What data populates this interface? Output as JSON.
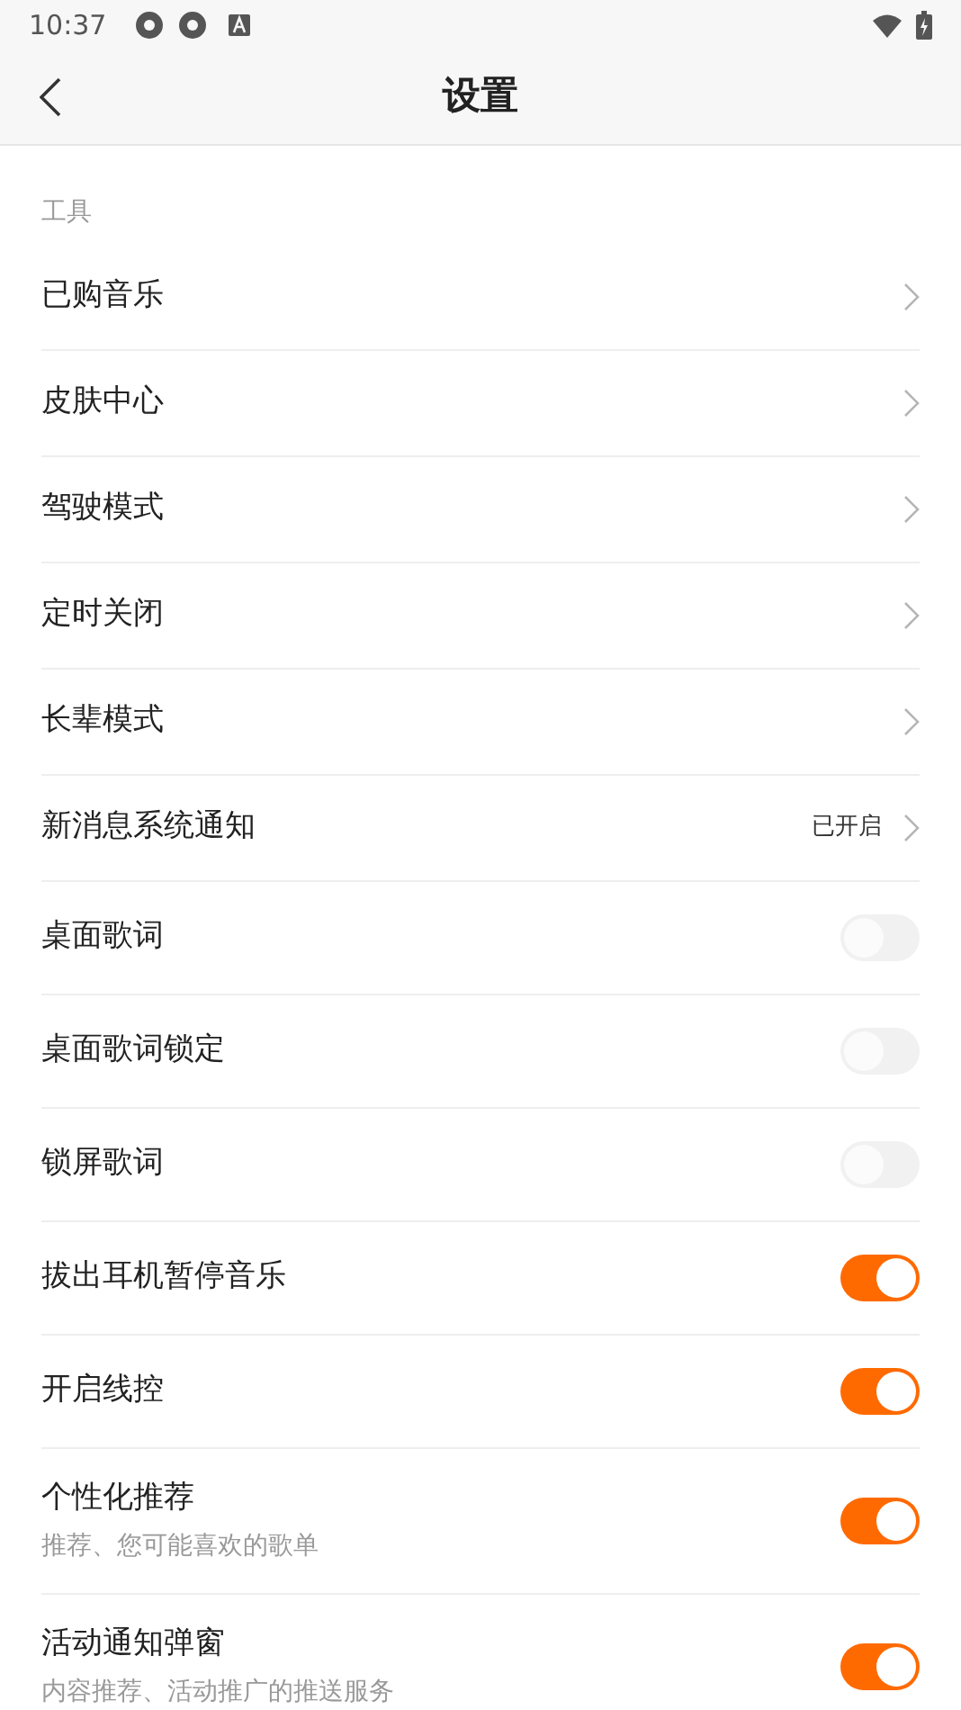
{
  "status_bar": {
    "time": "10:37"
  },
  "header": {
    "title": "设置"
  },
  "section": {
    "title": "工具"
  },
  "rows": [
    {
      "kind": "link",
      "label": "已购音乐"
    },
    {
      "kind": "link",
      "label": "皮肤中心"
    },
    {
      "kind": "link",
      "label": "驾驶模式"
    },
    {
      "kind": "link",
      "label": "定时关闭"
    },
    {
      "kind": "link",
      "label": "长辈模式"
    },
    {
      "kind": "link",
      "label": "新消息系统通知",
      "value": "已开启"
    },
    {
      "kind": "toggle",
      "label": "桌面歌词",
      "on": false
    },
    {
      "kind": "toggle",
      "label": "桌面歌词锁定",
      "on": false
    },
    {
      "kind": "toggle",
      "label": "锁屏歌词",
      "on": false
    },
    {
      "kind": "toggle",
      "label": "拔出耳机暂停音乐",
      "on": true
    },
    {
      "kind": "toggle",
      "label": "开启线控",
      "on": true
    },
    {
      "kind": "toggle",
      "label": "个性化推荐",
      "subtitle": "推荐、您可能喜欢的歌单",
      "on": true
    },
    {
      "kind": "toggle",
      "label": "活动通知弹窗",
      "subtitle": "内容推荐、活动推广的推送服务",
      "on": true
    }
  ]
}
